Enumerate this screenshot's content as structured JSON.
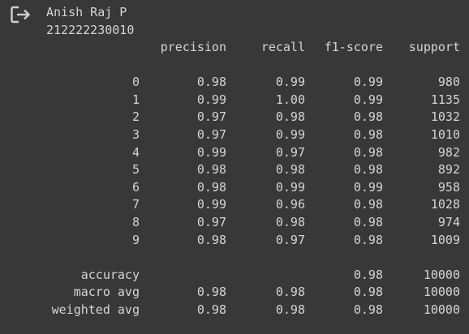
{
  "output": {
    "name_line": "Anish Raj P",
    "id_line": "212222230010"
  },
  "report": {
    "columns": [
      "precision",
      "recall",
      "f1-score",
      "support"
    ],
    "classes": [
      {
        "label": "0",
        "precision": "0.98",
        "recall": "0.99",
        "f1": "0.99",
        "support": "980"
      },
      {
        "label": "1",
        "precision": "0.99",
        "recall": "1.00",
        "f1": "0.99",
        "support": "1135"
      },
      {
        "label": "2",
        "precision": "0.97",
        "recall": "0.98",
        "f1": "0.98",
        "support": "1032"
      },
      {
        "label": "3",
        "precision": "0.97",
        "recall": "0.99",
        "f1": "0.98",
        "support": "1010"
      },
      {
        "label": "4",
        "precision": "0.99",
        "recall": "0.97",
        "f1": "0.98",
        "support": "982"
      },
      {
        "label": "5",
        "precision": "0.98",
        "recall": "0.98",
        "f1": "0.98",
        "support": "892"
      },
      {
        "label": "6",
        "precision": "0.98",
        "recall": "0.99",
        "f1": "0.99",
        "support": "958"
      },
      {
        "label": "7",
        "precision": "0.99",
        "recall": "0.96",
        "f1": "0.98",
        "support": "1028"
      },
      {
        "label": "8",
        "precision": "0.97",
        "recall": "0.98",
        "f1": "0.98",
        "support": "974"
      },
      {
        "label": "9",
        "precision": "0.98",
        "recall": "0.97",
        "f1": "0.98",
        "support": "1009"
      }
    ],
    "summary": [
      {
        "label": "accuracy",
        "precision": "",
        "recall": "",
        "f1": "0.98",
        "support": "10000"
      },
      {
        "label": "macro avg",
        "precision": "0.98",
        "recall": "0.98",
        "f1": "0.98",
        "support": "10000"
      },
      {
        "label": "weighted avg",
        "precision": "0.98",
        "recall": "0.98",
        "f1": "0.98",
        "support": "10000"
      }
    ]
  },
  "icons": {
    "output_action": "output-exit-icon"
  },
  "colors": {
    "background": "#383838",
    "text": "#d5d5d5",
    "icon": "#cfcfcf"
  }
}
